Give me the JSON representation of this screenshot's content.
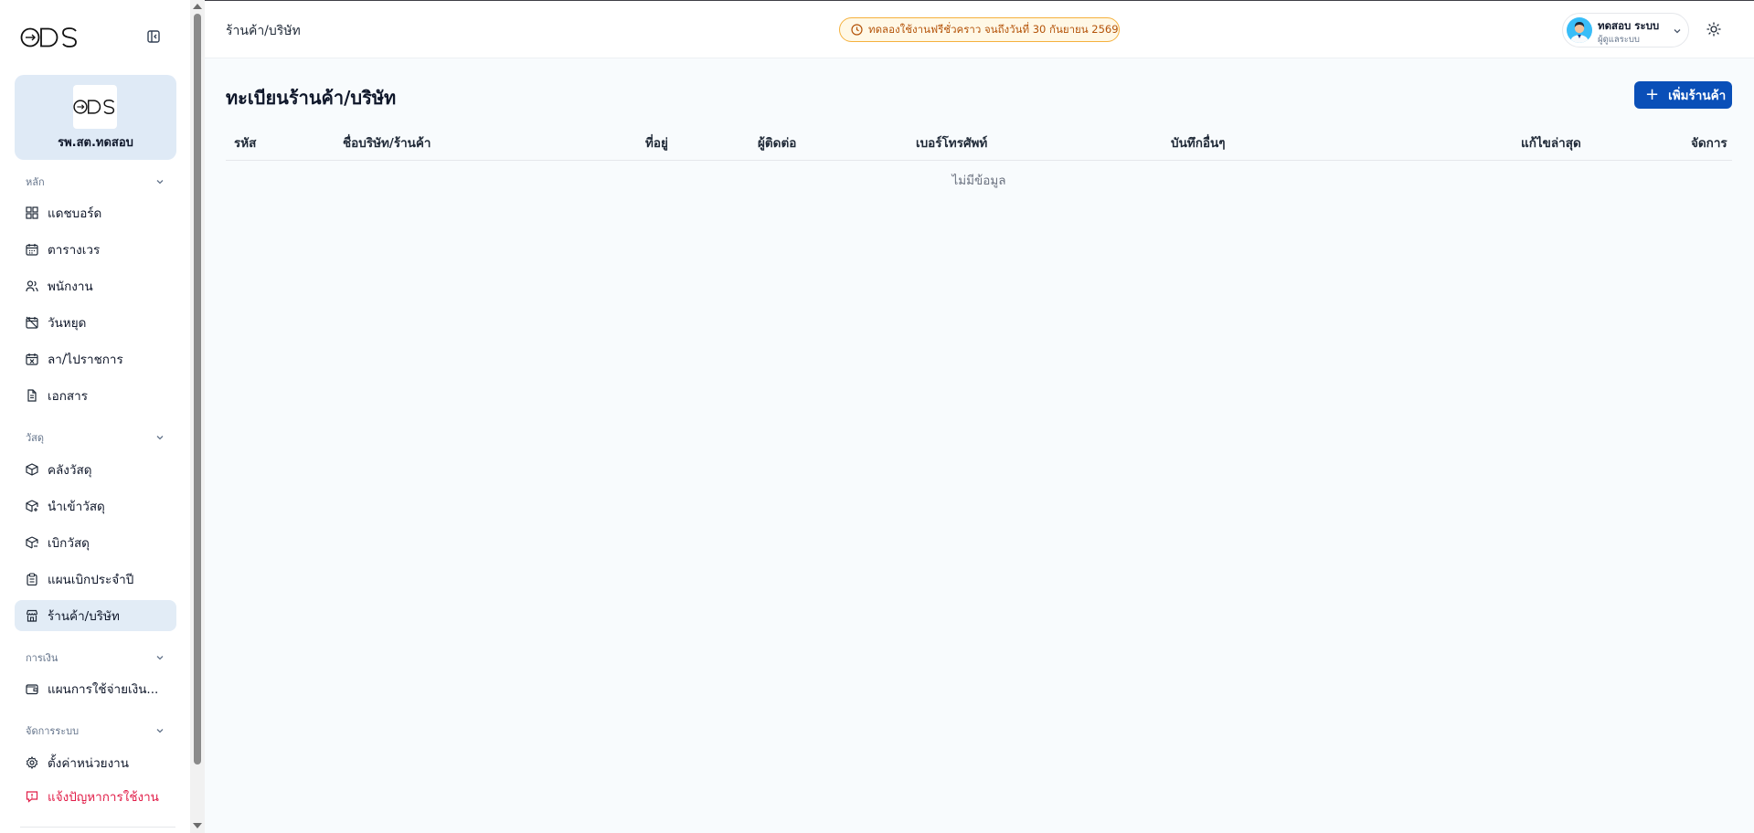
{
  "header": {
    "breadcrumb": "ร้านค้า/บริษัท",
    "trial_notice": "ทดลองใช้งานฟรีชั่วคราว จนถึงวันที่ 30 กันยายน 2569",
    "user": {
      "name": "ทดสอบ ระบบ",
      "role": "ผู้ดูแลระบบ"
    }
  },
  "sidebar": {
    "org_name": "รพ.สต.ทดสอบ",
    "sections": [
      {
        "label": "หลัก",
        "items": [
          {
            "label": "แดชบอร์ด",
            "icon": "dashboard-icon"
          },
          {
            "label": "ตารางเวร",
            "icon": "calendar-icon"
          },
          {
            "label": "พนักงาน",
            "icon": "users-icon"
          },
          {
            "label": "วันหยุด",
            "icon": "calendar-off-icon"
          },
          {
            "label": "ลา/ไปราชการ",
            "icon": "calendar-x-icon"
          },
          {
            "label": "เอกสาร",
            "icon": "document-icon"
          }
        ]
      },
      {
        "label": "วัสดุ",
        "items": [
          {
            "label": "คลังวัสดุ",
            "icon": "package-icon"
          },
          {
            "label": "นำเข้าวัสดุ",
            "icon": "package-in-icon"
          },
          {
            "label": "เบิกวัสดุ",
            "icon": "package-out-icon"
          },
          {
            "label": "แผนเบิกประจำปี",
            "icon": "clipboard-icon"
          },
          {
            "label": "ร้านค้า/บริษัท",
            "icon": "store-icon",
            "active": true
          }
        ]
      },
      {
        "label": "การเงิน",
        "items": [
          {
            "label": "แผนการใช้จ่ายเงิน...",
            "icon": "wallet-icon"
          }
        ]
      },
      {
        "label": "จัดการระบบ",
        "items": [
          {
            "label": "ตั้งค่าหน่วยงาน",
            "icon": "settings-icon"
          },
          {
            "label": "แจ้งปัญหาการใช้งาน",
            "icon": "alert-icon",
            "danger": true
          }
        ]
      }
    ]
  },
  "main": {
    "title": "ทะเบียนร้านค้า/บริษัท",
    "add_button": "เพิ่มร้านค้า",
    "columns": [
      "รหัส",
      "ชื่อบริษัท/ร้านค้า",
      "ที่อยู่",
      "ผู้ติดต่อ",
      "เบอร์โทรศัพท์",
      "บันทึกอื่นๆ",
      "แก้ไขล่าสุด",
      "จัดการ"
    ],
    "empty_text": "ไม่มีข้อมูล"
  },
  "colors": {
    "primary": "#0a4fb8",
    "sidebar_active": "#e2ecf6",
    "trial_border": "#f5b13d",
    "trial_text": "#b45309",
    "danger": "#e11d48"
  }
}
